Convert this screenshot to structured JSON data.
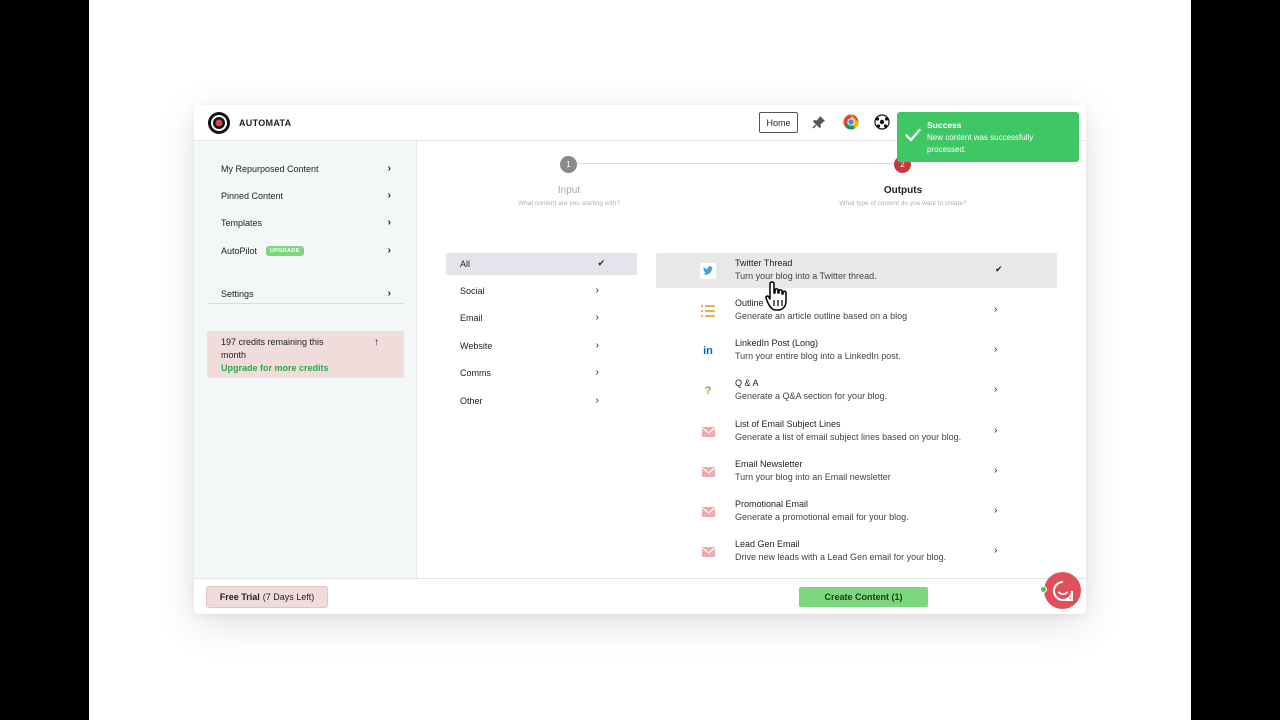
{
  "header": {
    "brand": "AUTOMATA",
    "home_label": "Home",
    "icons": [
      "pin-icon",
      "chrome-icon",
      "soccer-ball-icon"
    ]
  },
  "sidebar": {
    "items": [
      {
        "label": "My Repurposed Content"
      },
      {
        "label": "Pinned Content"
      },
      {
        "label": "Templates"
      },
      {
        "label": "AutoPilot",
        "badge": "UPGRADE"
      },
      {
        "label": "Settings"
      }
    ],
    "credits": {
      "text": "197 credits remaining this month",
      "link": "Upgrade for more credits"
    }
  },
  "steps": [
    {
      "number": "1",
      "title": "Input",
      "subtitle": "What content are you starting with?"
    },
    {
      "number": "2",
      "title": "Outputs",
      "subtitle": "What type of content do you want to create?"
    }
  ],
  "categories": [
    {
      "label": "All",
      "selected": true
    },
    {
      "label": "Social"
    },
    {
      "label": "Email"
    },
    {
      "label": "Website"
    },
    {
      "label": "Comms"
    },
    {
      "label": "Other"
    }
  ],
  "outputs": [
    {
      "title": "Twitter Thread",
      "desc": "Turn your blog into a Twitter thread.",
      "icon": "twitter-icon",
      "selected": true
    },
    {
      "title": "Outline",
      "desc": "Generate an article outline based on a blog",
      "icon": "list-icon"
    },
    {
      "title": "LinkedIn Post (Long)",
      "desc": "Turn your entire blog into a LinkedIn post.",
      "icon": "linkedin-icon"
    },
    {
      "title": "Q & A",
      "desc": "Generate a Q&A section for your blog.",
      "icon": "question-icon"
    },
    {
      "title": "List of Email Subject Lines",
      "desc": "Generate a list of email subject lines based on your blog.",
      "icon": "email-icon"
    },
    {
      "title": "Email Newsletter",
      "desc": "Turn your blog into an Email newsletter",
      "icon": "email-icon"
    },
    {
      "title": "Promotional Email",
      "desc": "Generate a promotional email for your blog.",
      "icon": "email-icon"
    },
    {
      "title": "Lead Gen Email",
      "desc": "Drive new leads with a Lead Gen email for your blog.",
      "icon": "email-icon"
    }
  ],
  "footer": {
    "trial_bold": "Free Trial",
    "trial_rest": "(7 Days Left)",
    "create_label": "Create Content (1)"
  },
  "toast": {
    "title": "Success",
    "message": "New content was successfully processed."
  },
  "colors": {
    "accent_green": "#7ed67e",
    "toast_green": "#3fc764",
    "step_active": "#c9363f",
    "step_inactive": "#8a8a8a",
    "credits_bg": "#f1dcdc"
  }
}
